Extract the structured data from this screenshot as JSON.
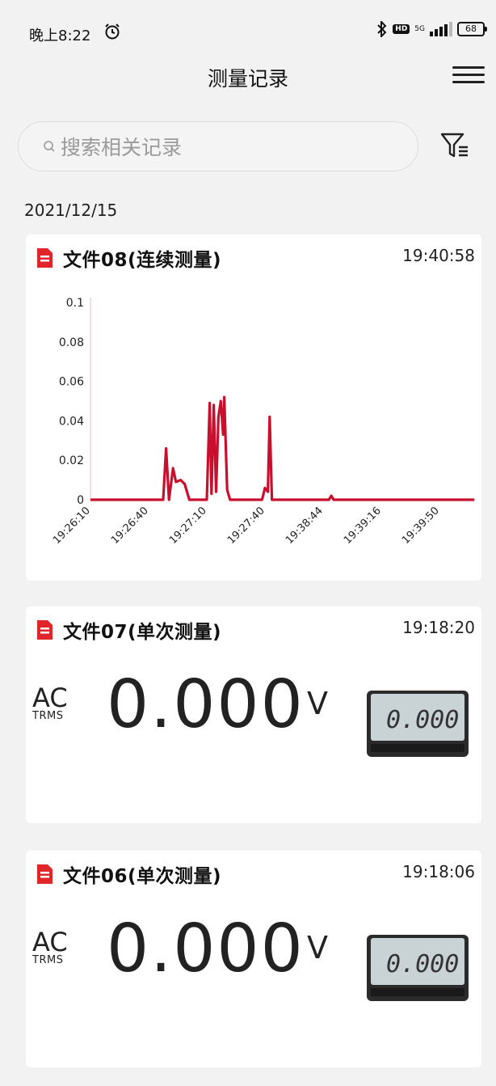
{
  "status_bar": {
    "time": "晚上8:22",
    "network": "5G",
    "battery": "68"
  },
  "header": {
    "title": "测量记录"
  },
  "search": {
    "placeholder": "搜索相关记录"
  },
  "date_group": "2021/12/15",
  "records": [
    {
      "title": "文件08(连续测量)",
      "time": "19:40:58",
      "chart_data": {
        "type": "line",
        "y_ticks": [
          "0.1",
          "0.08",
          "0.06",
          "0.04",
          "0.02",
          "0"
        ],
        "x_ticks": [
          "19:26:10",
          "19:26:40",
          "19:27:10",
          "19:27:40",
          "19:38:44",
          "19:39:16",
          "19:39:50"
        ],
        "ylim": [
          0,
          0.1
        ],
        "series_color": "#c8102e",
        "points": [
          [
            0,
            0
          ],
          [
            1.25,
            0
          ],
          [
            1.3,
            0.026
          ],
          [
            1.35,
            0
          ],
          [
            1.42,
            0.016
          ],
          [
            1.47,
            0.009
          ],
          [
            1.55,
            0.01
          ],
          [
            1.62,
            0.008
          ],
          [
            1.7,
            0
          ],
          [
            2.0,
            0
          ],
          [
            2.05,
            0.049
          ],
          [
            2.08,
            0.003
          ],
          [
            2.12,
            0.048
          ],
          [
            2.16,
            0.004
          ],
          [
            2.2,
            0.042
          ],
          [
            2.24,
            0.05
          ],
          [
            2.28,
            0.033
          ],
          [
            2.3,
            0.052
          ],
          [
            2.35,
            0.005
          ],
          [
            2.4,
            0
          ],
          [
            2.95,
            0
          ],
          [
            3.0,
            0.006
          ],
          [
            3.05,
            0.004
          ],
          [
            3.08,
            0.042
          ],
          [
            3.12,
            0
          ],
          [
            4.1,
            0
          ],
          [
            4.14,
            0.002
          ],
          [
            4.18,
            0
          ],
          [
            6.6,
            0
          ]
        ]
      }
    },
    {
      "title": "文件07(单次测量)",
      "time": "19:18:20",
      "mode": "AC",
      "mode_sub": "TRMS",
      "value": "0.000",
      "unit": "V",
      "lcd_value": "0.000"
    },
    {
      "title": "文件06(单次测量)",
      "time": "19:18:06",
      "mode": "AC",
      "mode_sub": "TRMS",
      "value": "0.000",
      "unit": "V",
      "lcd_value": "0.000"
    }
  ],
  "icons": {
    "alarm": "alarm-clock-icon",
    "bluetooth": "bluetooth-icon",
    "signal": "signal-icon",
    "menu": "menu-icon",
    "search": "search-icon",
    "filter": "filter-icon",
    "file": "file-icon"
  },
  "colors": {
    "accent": "#e0262b",
    "chart_line": "#c8102e",
    "lcd": "#c9d3d6"
  }
}
